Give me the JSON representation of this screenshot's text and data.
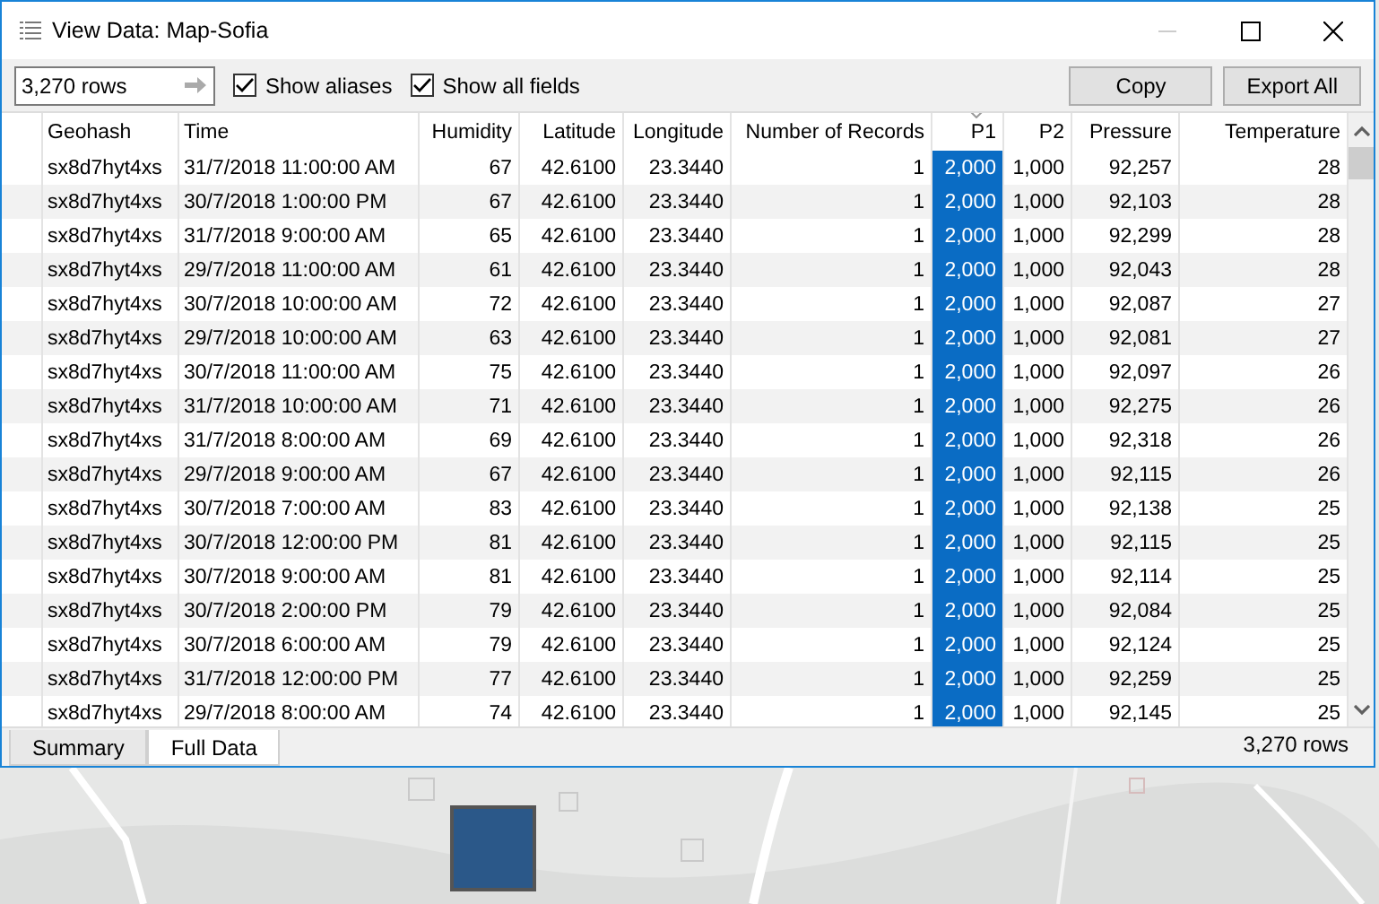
{
  "window": {
    "title": "View Data:  Map-Sofia"
  },
  "toolbar": {
    "rows_field": "3,270 rows",
    "show_aliases": {
      "label": "Show aliases",
      "checked": true
    },
    "show_all_fields": {
      "label": "Show all fields",
      "checked": true
    },
    "buttons": [
      "Copy",
      "Export All"
    ]
  },
  "table": {
    "columns": [
      {
        "label": "Geohash",
        "kind": "text",
        "selected": false,
        "sorted": false
      },
      {
        "label": "Time",
        "kind": "text",
        "selected": false,
        "sorted": false
      },
      {
        "label": "Humidity",
        "kind": "number",
        "selected": false,
        "sorted": false
      },
      {
        "label": "Latitude",
        "kind": "number",
        "selected": false,
        "sorted": false
      },
      {
        "label": "Longitude",
        "kind": "number",
        "selected": false,
        "sorted": false
      },
      {
        "label": "Number of Records",
        "kind": "number",
        "selected": false,
        "sorted": false
      },
      {
        "label": "P1",
        "kind": "number",
        "selected": true,
        "sorted": true
      },
      {
        "label": "P2",
        "kind": "number",
        "selected": false,
        "sorted": false
      },
      {
        "label": "Pressure",
        "kind": "number",
        "selected": false,
        "sorted": false
      },
      {
        "label": "Temperature",
        "kind": "number",
        "selected": false,
        "sorted": false
      }
    ],
    "rows": [
      [
        "sx8d7hyt4xs",
        "31/7/2018 11:00:00 AM",
        "67",
        "42.6100",
        "23.3440",
        "1",
        "2,000",
        "1,000",
        "92,257",
        "28"
      ],
      [
        "sx8d7hyt4xs",
        "30/7/2018 1:00:00 PM",
        "67",
        "42.6100",
        "23.3440",
        "1",
        "2,000",
        "1,000",
        "92,103",
        "28"
      ],
      [
        "sx8d7hyt4xs",
        "31/7/2018 9:00:00 AM",
        "65",
        "42.6100",
        "23.3440",
        "1",
        "2,000",
        "1,000",
        "92,299",
        "28"
      ],
      [
        "sx8d7hyt4xs",
        "29/7/2018 11:00:00 AM",
        "61",
        "42.6100",
        "23.3440",
        "1",
        "2,000",
        "1,000",
        "92,043",
        "28"
      ],
      [
        "sx8d7hyt4xs",
        "30/7/2018 10:00:00 AM",
        "72",
        "42.6100",
        "23.3440",
        "1",
        "2,000",
        "1,000",
        "92,087",
        "27"
      ],
      [
        "sx8d7hyt4xs",
        "29/7/2018 10:00:00 AM",
        "63",
        "42.6100",
        "23.3440",
        "1",
        "2,000",
        "1,000",
        "92,081",
        "27"
      ],
      [
        "sx8d7hyt4xs",
        "30/7/2018 11:00:00 AM",
        "75",
        "42.6100",
        "23.3440",
        "1",
        "2,000",
        "1,000",
        "92,097",
        "26"
      ],
      [
        "sx8d7hyt4xs",
        "31/7/2018 10:00:00 AM",
        "71",
        "42.6100",
        "23.3440",
        "1",
        "2,000",
        "1,000",
        "92,275",
        "26"
      ],
      [
        "sx8d7hyt4xs",
        "31/7/2018 8:00:00 AM",
        "69",
        "42.6100",
        "23.3440",
        "1",
        "2,000",
        "1,000",
        "92,318",
        "26"
      ],
      [
        "sx8d7hyt4xs",
        "29/7/2018 9:00:00 AM",
        "67",
        "42.6100",
        "23.3440",
        "1",
        "2,000",
        "1,000",
        "92,115",
        "26"
      ],
      [
        "sx8d7hyt4xs",
        "30/7/2018 7:00:00 AM",
        "83",
        "42.6100",
        "23.3440",
        "1",
        "2,000",
        "1,000",
        "92,138",
        "25"
      ],
      [
        "sx8d7hyt4xs",
        "30/7/2018 12:00:00 PM",
        "81",
        "42.6100",
        "23.3440",
        "1",
        "2,000",
        "1,000",
        "92,115",
        "25"
      ],
      [
        "sx8d7hyt4xs",
        "30/7/2018 9:00:00 AM",
        "81",
        "42.6100",
        "23.3440",
        "1",
        "2,000",
        "1,000",
        "92,114",
        "25"
      ],
      [
        "sx8d7hyt4xs",
        "30/7/2018 2:00:00 PM",
        "79",
        "42.6100",
        "23.3440",
        "1",
        "2,000",
        "1,000",
        "92,084",
        "25"
      ],
      [
        "sx8d7hyt4xs",
        "30/7/2018 6:00:00 AM",
        "79",
        "42.6100",
        "23.3440",
        "1",
        "2,000",
        "1,000",
        "92,124",
        "25"
      ],
      [
        "sx8d7hyt4xs",
        "31/7/2018 12:00:00 PM",
        "77",
        "42.6100",
        "23.3440",
        "1",
        "2,000",
        "1,000",
        "92,259",
        "25"
      ],
      [
        "sx8d7hyt4xs",
        "29/7/2018 8:00:00 AM",
        "74",
        "42.6100",
        "23.3440",
        "1",
        "2,000",
        "1,000",
        "92,145",
        "25"
      ]
    ]
  },
  "tabs": [
    {
      "label": "Summary",
      "selected": false
    },
    {
      "label": "Full Data",
      "selected": true
    }
  ],
  "status": "3,270 rows"
}
